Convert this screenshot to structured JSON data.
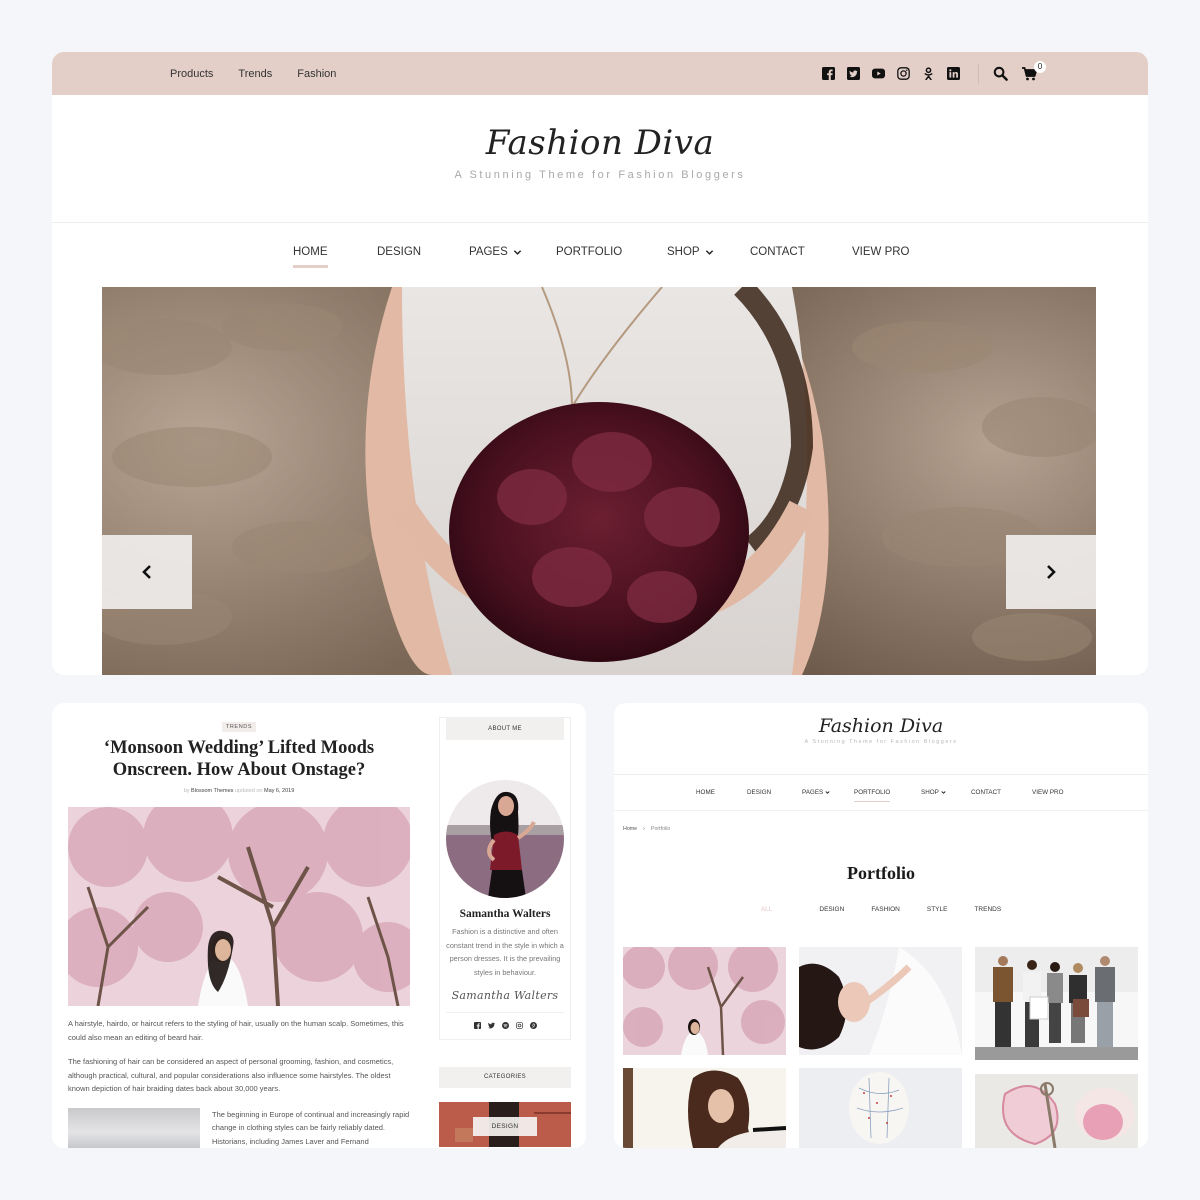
{
  "topbar": {
    "secondary_nav": [
      "Products",
      "Trends",
      "Fashion"
    ],
    "social_icons": [
      "facebook-icon",
      "twitter-icon",
      "youtube-icon",
      "instagram-icon",
      "odnoklassniki-icon",
      "linkedin-icon"
    ],
    "cart_count": "0",
    "bg_color": "#e3cfc8"
  },
  "site": {
    "title": "Fashion Diva",
    "tagline": "A Stunning Theme for Fashion Bloggers"
  },
  "main_nav": {
    "items": [
      {
        "label": "HOME",
        "active": true,
        "dropdown": false
      },
      {
        "label": "DESIGN",
        "active": false,
        "dropdown": false
      },
      {
        "label": "PAGES",
        "active": false,
        "dropdown": true
      },
      {
        "label": "PORTFOLIO",
        "active": false,
        "dropdown": false
      },
      {
        "label": "SHOP",
        "active": false,
        "dropdown": true
      },
      {
        "label": "CONTACT",
        "active": false,
        "dropdown": false
      },
      {
        "label": "VIEW PRO",
        "active": false,
        "dropdown": false
      }
    ]
  },
  "slider": {
    "prev_icon": "chevron-left-icon",
    "next_icon": "chevron-right-icon"
  },
  "post": {
    "category": "TRENDS",
    "title": "‘Monsoon Wedding’ Lifted Moods Onscreen. How About Onstage?",
    "meta_by": "by",
    "author": "Blossom Themes",
    "meta_updated": "updated on",
    "date": "May 6, 2019",
    "paragraphs": [
      "A hairstyle, hairdo, or haircut refers to the styling of hair, usually on the human scalp. Sometimes, this could also mean an editing of beard hair.",
      "The fashioning of hair can be considered an aspect of personal grooming, fashion, and cosmetics, although practical, cultural, and popular considerations also influence some hairstyles. The oldest known depiction of hair braiding dates back about 30,000 years."
    ],
    "inline_text": "The beginning in Europe of continual and increasingly rapid change in clothing styles can be fairly reliably dated. Historians, including James Laver and Fernand"
  },
  "sidebar": {
    "about": {
      "heading": "ABOUT ME",
      "name": "Samantha Walters",
      "bio": "Fashion is a distinctive and often constant trend in the style in which a person dresses. It is the prevailing styles in behaviour.",
      "signature": "Samantha Walters",
      "social_icons": [
        "facebook-icon",
        "twitter-icon",
        "spotify-icon",
        "instagram-icon",
        "pinterest-icon"
      ]
    },
    "categories": {
      "heading": "CATEGORIES",
      "first_label": "DESIGN"
    }
  },
  "portfolio_page": {
    "site_title": "Fashion Diva",
    "tagline": "A Stunning Theme for Fashion Bloggers",
    "nav": [
      {
        "label": "HOME",
        "active": false,
        "dropdown": false
      },
      {
        "label": "DESIGN",
        "active": false,
        "dropdown": false
      },
      {
        "label": "PAGES",
        "active": false,
        "dropdown": true
      },
      {
        "label": "PORTFOLIO",
        "active": true,
        "dropdown": false
      },
      {
        "label": "SHOP",
        "active": false,
        "dropdown": true
      },
      {
        "label": "CONTACT",
        "active": false,
        "dropdown": false
      },
      {
        "label": "VIEW PRO",
        "active": false,
        "dropdown": false
      }
    ],
    "breadcrumb": {
      "home": "Home",
      "separator": "›",
      "current": "Portfolio"
    },
    "title": "Portfolio",
    "filters": [
      {
        "label": "ALL",
        "active": true
      },
      {
        "label": "DESIGN",
        "active": false
      },
      {
        "label": "FASHION",
        "active": false
      },
      {
        "label": "STYLE",
        "active": false
      },
      {
        "label": "TRENDS",
        "active": false
      }
    ],
    "items": [
      "cherry-blossom-woman",
      "woman-lying-on-bed",
      "friends-shopping",
      "curly-hair-woman",
      "acupuncture-head-model",
      "rose-and-vintage-key"
    ]
  },
  "colors": {
    "accent": "#e3cfc8",
    "page_bg": "#f4f6f9",
    "active_filter": "#e7c9c8"
  }
}
